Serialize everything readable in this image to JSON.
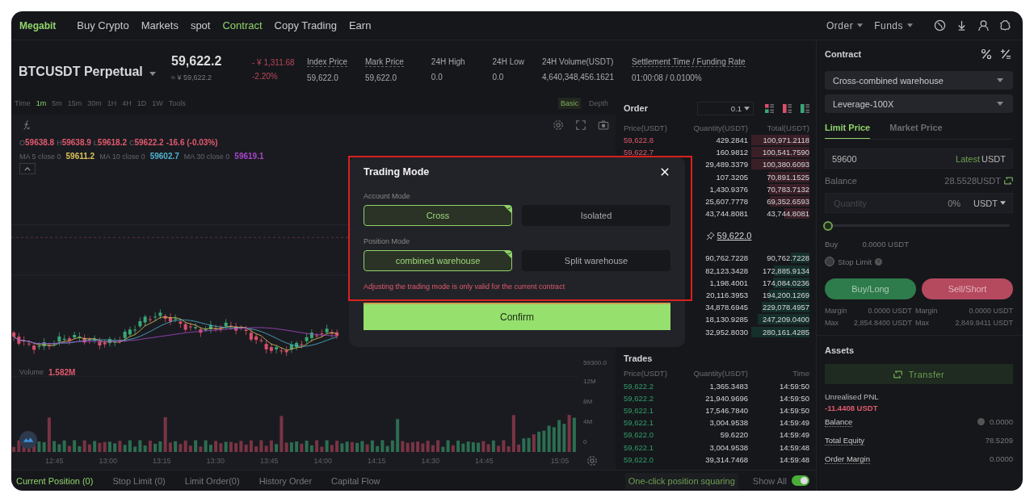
{
  "nav": {
    "logo": "Megabit",
    "links": [
      {
        "label": "Buy Crypto",
        "selected": false
      },
      {
        "label": "Markets",
        "selected": false
      },
      {
        "label": "spot",
        "selected": false
      },
      {
        "label": "Contract",
        "selected": true
      },
      {
        "label": "Copy Trading",
        "selected": false
      },
      {
        "label": "Earn",
        "selected": false
      }
    ],
    "menus": [
      "Order",
      "Funds"
    ]
  },
  "ticker": {
    "symbol": "BTCUSDT Perpetual",
    "price": "59,622.2",
    "approx": "≈ ¥ 59,622.2",
    "change": "- ¥ 1,311.68",
    "change_pct": "-2.20%",
    "stats": [
      {
        "label": "Index Price",
        "value": "59,622.0",
        "underlined": true
      },
      {
        "label": "Mark Price",
        "value": "59,622.0",
        "underlined": true
      },
      {
        "label": "24H High",
        "value": "0.0",
        "underlined": false
      },
      {
        "label": "24H Low",
        "value": "0.0",
        "underlined": false
      },
      {
        "label": "24H Volume(USDT)",
        "value": "4,640,348,456.1621",
        "underlined": false
      },
      {
        "label": "Settlement Time / Funding Rate",
        "value": "01:00:08 / 0.0100%",
        "underlined": true
      }
    ]
  },
  "intervals": [
    {
      "label": "Time",
      "selected": false
    },
    {
      "label": "1m",
      "selected": true
    },
    {
      "label": "5m",
      "selected": false
    },
    {
      "label": "15m",
      "selected": false
    },
    {
      "label": "30m",
      "selected": false
    },
    {
      "label": "1H",
      "selected": false
    },
    {
      "label": "4H",
      "selected": false
    },
    {
      "label": "1D",
      "selected": false
    },
    {
      "label": "1W",
      "selected": false
    },
    {
      "label": "Tools",
      "selected": false
    }
  ],
  "chart_views": [
    {
      "label": "Basic",
      "selected": true
    },
    {
      "label": "Depth",
      "selected": false
    }
  ],
  "chart": {
    "ohlc": [
      {
        "label": "O",
        "value": "59638.8"
      },
      {
        "label": "H",
        "value": "59638.9"
      },
      {
        "label": "L",
        "value": "59618.2"
      },
      {
        "label": "C",
        "value": "59622.2"
      }
    ],
    "change": "-16.6 (-0.03%)",
    "ma": [
      {
        "label": "MA 5 close 0",
        "value": "59611.2",
        "color": "#d9c25a"
      },
      {
        "label": "MA 10 close 0",
        "value": "59602.7",
        "color": "#4fb3cf"
      },
      {
        "label": "MA 30 close 0",
        "value": "59619.1",
        "color": "#a647c9"
      }
    ],
    "volume_label": "Volume",
    "volume_value": "1.582M",
    "axis_labels": [
      {
        "kind": "price",
        "text": "59300.0"
      },
      {
        "kind": "volume",
        "text": "12M"
      },
      {
        "kind": "volume",
        "text": "8M"
      },
      {
        "kind": "volume",
        "text": "4M"
      },
      {
        "kind": "volume",
        "text": "0"
      }
    ],
    "time_labels": [
      "12:45",
      "13:00",
      "13:15",
      "13:30",
      "13:45",
      "14:00",
      "14:15",
      "14:30",
      "14:45",
      "15:05"
    ]
  },
  "order_book": {
    "title": "Order",
    "step": "0.1",
    "columns": [
      "Price(USDT)",
      "Quantity(USDT)",
      "Total(USDT)"
    ],
    "asks": [
      {
        "price": "59,622.8",
        "quantity": "429.2841",
        "total": "100,971.2118"
      },
      {
        "price": "59,622.7",
        "quantity": "160.9812",
        "total": "100,541.7590"
      },
      {
        "quantity": "29,489.3379",
        "total": "100,380.6093"
      },
      {
        "quantity": "107.3205",
        "total": "70,891.1525"
      },
      {
        "quantity": "1,430.9376",
        "total": "70,783.7132"
      },
      {
        "quantity": "25,607.7778",
        "total": "69,352.6593"
      },
      {
        "quantity": "43,744.8081",
        "total": "43,744.8081"
      }
    ],
    "mid_price": "59,622.0",
    "bids": [
      {
        "quantity": "90,762.7228",
        "total": "90,762.7228"
      },
      {
        "quantity": "82,123.3428",
        "total": "172,885.9134"
      },
      {
        "quantity": "1,198.4001",
        "total": "174,084.0236"
      },
      {
        "quantity": "20,116.3953",
        "total": "194,200.1269"
      },
      {
        "quantity": "34,878.6945",
        "total": "229,078.4957"
      },
      {
        "quantity": "18,130.9285",
        "total": "247,209.0400"
      },
      {
        "quantity": "32,952.8030",
        "total": "280,161.4285"
      }
    ]
  },
  "trades": {
    "title": "Trades",
    "columns": [
      "Price(USDT)",
      "Quantity(USDT)",
      "Time"
    ],
    "rows": [
      {
        "price": "59,622.2",
        "quantity": "1,365.3483",
        "time": "14:59:50"
      },
      {
        "price": "59,622.2",
        "quantity": "21,940.9696",
        "time": "14:59:50"
      },
      {
        "price": "59,622.1",
        "quantity": "17,546.7840",
        "time": "14:59:50"
      },
      {
        "price": "59,622.1",
        "quantity": "3,004.9538",
        "time": "14:59:49"
      },
      {
        "price": "59,622.0",
        "quantity": "59.6220",
        "time": "14:59:49"
      },
      {
        "price": "59,622.1",
        "quantity": "3,004.9538",
        "time": "14:59:48"
      },
      {
        "price": "59,622.0",
        "quantity": "39,314.7468",
        "time": "14:59:48"
      }
    ]
  },
  "bottom_tabs": [
    {
      "label": "Current Position (0)",
      "selected": true
    },
    {
      "label": "Stop Limit (0)",
      "selected": false
    },
    {
      "label": "Limit Order(0)",
      "selected": false
    },
    {
      "label": "History Order",
      "selected": false
    },
    {
      "label": "Capital Flow",
      "selected": false
    }
  ],
  "bottom_actions": {
    "squaring": "One-click position squaring",
    "show_all": "Show All",
    "show_all_on": true
  },
  "contract": {
    "title": "Contract",
    "dropdowns": [
      "Cross-combined warehouse",
      "Leverage-100X"
    ],
    "tabs": [
      {
        "label": "Limit Price",
        "selected": true
      },
      {
        "label": "Market Price",
        "selected": false
      }
    ],
    "price_value": "59600",
    "latest": "Latest",
    "price_unit": "USDT",
    "balance_label": "Balance",
    "balance_value": "28.5528USDT",
    "quantity_placeholder": "Quantity",
    "quantity_pct": "0%",
    "quantity_unit": "USDT",
    "slider": {
      "level": 0
    },
    "buy_label": "Buy",
    "buy_value": "0.0000 USDT",
    "stop_limit": {
      "label": "Stop Limit",
      "checked": false
    },
    "buy_button": "Buy/Long",
    "sell_button": "Sell/Short",
    "margins": [
      [
        {
          "label": "Margin",
          "value": "0.0000 USDT"
        },
        {
          "label": "Margin",
          "value": "0.0000 USDT"
        }
      ],
      [
        {
          "label": "Max",
          "value": "2,854.8400 USDT"
        },
        {
          "label": "Max",
          "value": "2,849.9411 USDT"
        }
      ]
    ]
  },
  "assets": {
    "title": "Assets",
    "transfer": "Transfer",
    "pnl_label": "Unrealised PNL",
    "pnl_value": "-11.4408 USDT",
    "rows": [
      {
        "label": "Balance",
        "value": "0.0000",
        "coin": true
      },
      {
        "label": "Total Equity",
        "value": "78.5209",
        "coin": false
      },
      {
        "label": "Order Margin",
        "value": "0.0000",
        "coin": false
      }
    ]
  },
  "modal": {
    "title": "Trading Mode",
    "sections": [
      {
        "label": "Account Mode",
        "options": [
          {
            "label": "Cross",
            "selected": true
          },
          {
            "label": "Isolated",
            "selected": false
          }
        ]
      },
      {
        "label": "Position Mode",
        "options": [
          {
            "label": "combined warehouse",
            "selected": true
          },
          {
            "label": "Split warehouse",
            "selected": false
          }
        ]
      }
    ],
    "note": "Adjusting the trading mode is only valid for the current contract",
    "confirm": "Confirm"
  }
}
